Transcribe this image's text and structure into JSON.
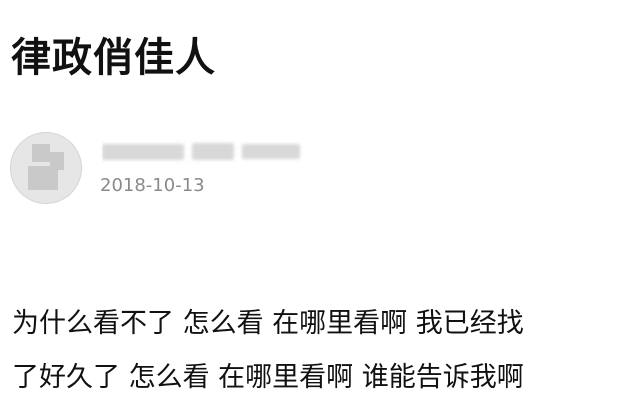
{
  "post": {
    "title": "律政俏佳人",
    "date": "2018-10-13",
    "body_lines": [
      "为什么看不了 怎么看 在哪里看啊 我已经找",
      "了好久了 怎么看 在哪里看啊 谁能告诉我啊"
    ]
  },
  "colors": {
    "text": "#111111",
    "meta": "#8a8a8a",
    "avatar_placeholder": "#e6e6e6"
  }
}
